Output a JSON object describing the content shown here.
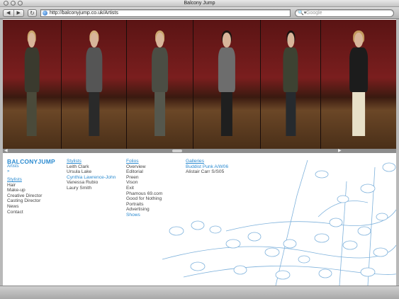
{
  "window": {
    "title": "Balcony Jump"
  },
  "toolbar": {
    "back_glyph": "◀",
    "forward_glyph": "▶",
    "reload_glyph": "↻",
    "url": "http://balconyjump.co.uk/Artists",
    "search_placeholder": "Google",
    "search_icon_glyph": "🔍▾"
  },
  "photos": [
    {
      "hair": "#c9a56a",
      "top": "#3a3a2e",
      "legs": "#4a4a3a"
    },
    {
      "hair": "#d4b07a",
      "top": "#555",
      "legs": "#2a2a2a"
    },
    {
      "hair": "#caa66c",
      "top": "#4b4d44",
      "legs": "#55574d"
    },
    {
      "hair": "#1e1510",
      "top": "#6d6d6d",
      "legs": "#1f1f1f"
    },
    {
      "hair": "#1a1210",
      "top": "#3d4232",
      "legs": "#262a2e"
    },
    {
      "hair": "#c39a5e",
      "top": "#1c1c1c",
      "legs": "#e8e0c8"
    }
  ],
  "nav": {
    "logo": "BALCONYJUMP",
    "section": "Artists",
    "marker": "»",
    "stylists_link": "Stylists",
    "categories": [
      "Hair",
      "Make-up",
      "Creative Director",
      "Casting Director",
      "News",
      "Contact"
    ]
  },
  "stylists": {
    "heading": "Stylists",
    "names": [
      "Leith Clark",
      "Ursula Lake"
    ],
    "highlighted": "Cynthia Lawrence-John",
    "more": [
      "Vanessa Rubio",
      "Laury Smith"
    ]
  },
  "folios": {
    "heading": "Folios",
    "items": [
      "Overview",
      "Editorial",
      "Preen",
      "Vison",
      "Exit",
      "Phamous 69.com",
      "Good for Nothing",
      "Portraits",
      "Advertising"
    ],
    "shows": "Shows"
  },
  "galleries": {
    "heading": "Galleries",
    "highlighted": "Buddist Punk A/W06",
    "items": [
      "Alistair Carr S/S05"
    ]
  },
  "colors": {
    "accent": "#2a8ad0",
    "illustration": "#7fb2dc"
  }
}
